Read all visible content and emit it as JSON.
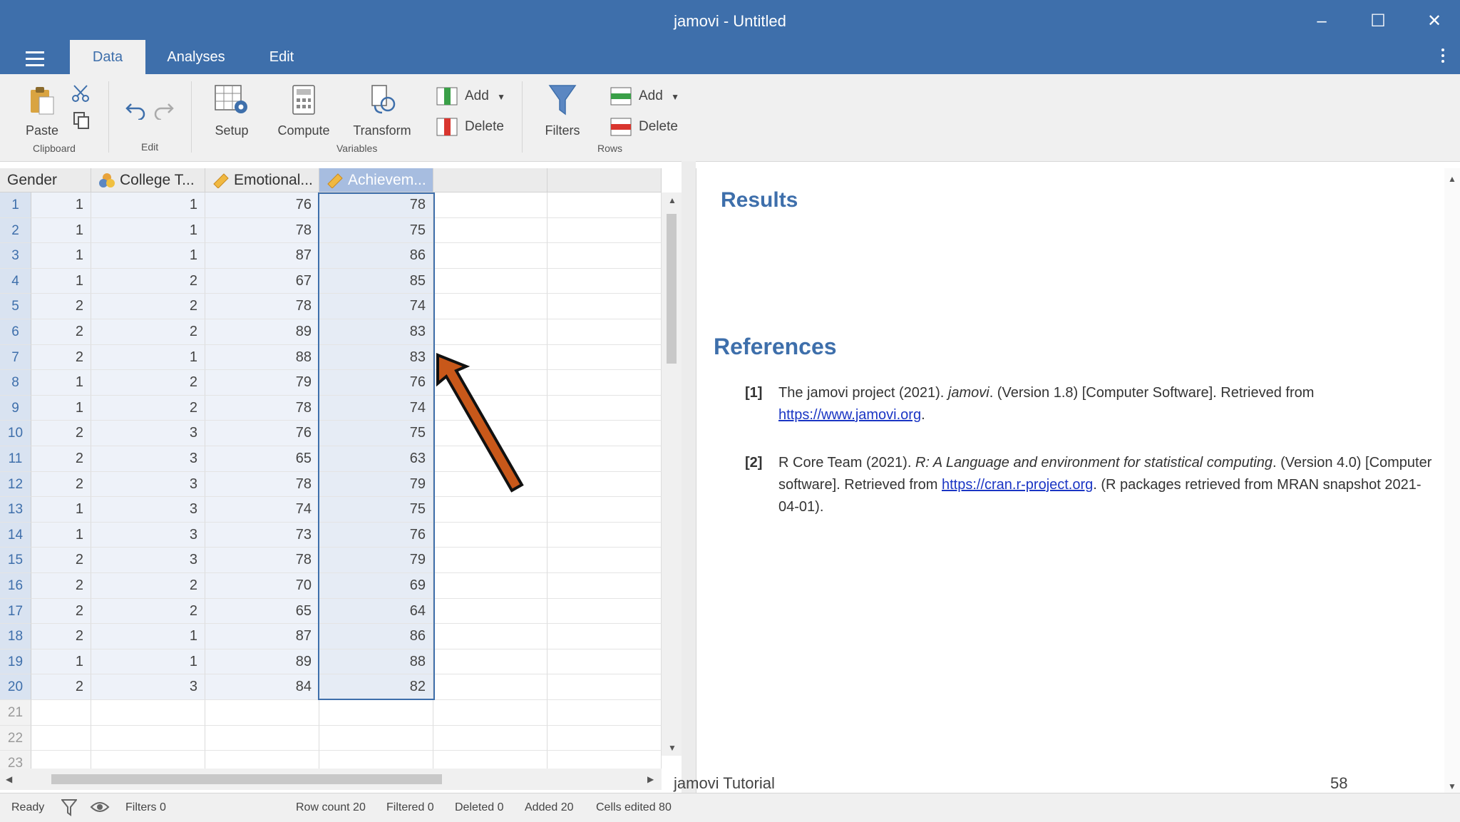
{
  "window": {
    "title": "jamovi - Untitled"
  },
  "tabs": [
    {
      "label": "Data",
      "active": true
    },
    {
      "label": "Analyses",
      "active": false
    },
    {
      "label": "Edit",
      "active": false
    }
  ],
  "ribbon": {
    "paste": "Paste",
    "clipboard_group": "Clipboard",
    "edit_group": "Edit",
    "setup": "Setup",
    "compute": "Compute",
    "transform": "Transform",
    "var_add": "Add",
    "var_delete": "Delete",
    "variables_group": "Variables",
    "filters": "Filters",
    "row_add": "Add",
    "row_delete": "Delete",
    "rows_group": "Rows"
  },
  "columns": [
    {
      "name": "Gender",
      "icon": "none"
    },
    {
      "name": "College T...",
      "icon": "nominal-icon"
    },
    {
      "name": "Emotional...",
      "icon": "continuous-icon"
    },
    {
      "name": "Achievem...",
      "icon": "continuous-icon",
      "selected": true
    }
  ],
  "rows": [
    [
      1,
      1,
      76,
      78
    ],
    [
      1,
      1,
      78,
      75
    ],
    [
      1,
      1,
      87,
      86
    ],
    [
      1,
      2,
      67,
      85
    ],
    [
      2,
      2,
      78,
      74
    ],
    [
      2,
      2,
      89,
      83
    ],
    [
      2,
      1,
      88,
      83
    ],
    [
      1,
      2,
      79,
      76
    ],
    [
      1,
      2,
      78,
      74
    ],
    [
      2,
      3,
      76,
      75
    ],
    [
      2,
      3,
      65,
      63
    ],
    [
      2,
      3,
      78,
      79
    ],
    [
      1,
      3,
      74,
      75
    ],
    [
      1,
      3,
      73,
      76
    ],
    [
      2,
      3,
      78,
      79
    ],
    [
      2,
      2,
      70,
      69
    ],
    [
      2,
      2,
      65,
      64
    ],
    [
      2,
      1,
      87,
      86
    ],
    [
      1,
      1,
      89,
      88
    ],
    [
      2,
      3,
      84,
      82
    ]
  ],
  "empty_row_numbers": [
    21,
    22,
    23
  ],
  "results": {
    "title": "Results",
    "references_title": "References",
    "references": [
      {
        "num": "[1]",
        "text_before": "The jamovi project (2021). ",
        "italic": "jamovi",
        "text_after": ". (Version 1.8) [Computer Software]. Retrieved from ",
        "link": "https://www.jamovi.org",
        "text_end": "."
      },
      {
        "num": "[2]",
        "text_before": "R Core Team (2021). ",
        "italic": "R: A Language and environment for statistical computing",
        "text_after": ". (Version 4.0) [Computer software]. Retrieved from ",
        "link": "https://cran.r-project.org",
        "text_end": ". (R packages retrieved from MRAN snapshot 2021-04-01)."
      }
    ],
    "footer_left": "jamovi Tutorial",
    "footer_right": "58"
  },
  "status": {
    "ready": "Ready",
    "filters": "Filters 0",
    "row_count": "Row count 20",
    "filtered": "Filtered 0",
    "deleted": "Deleted 0",
    "added": "Added 20",
    "cells_edited": "Cells edited 80"
  },
  "colors": {
    "brand": "#3e6fab",
    "arrow": "#c8581a",
    "link": "#1a35c4"
  }
}
